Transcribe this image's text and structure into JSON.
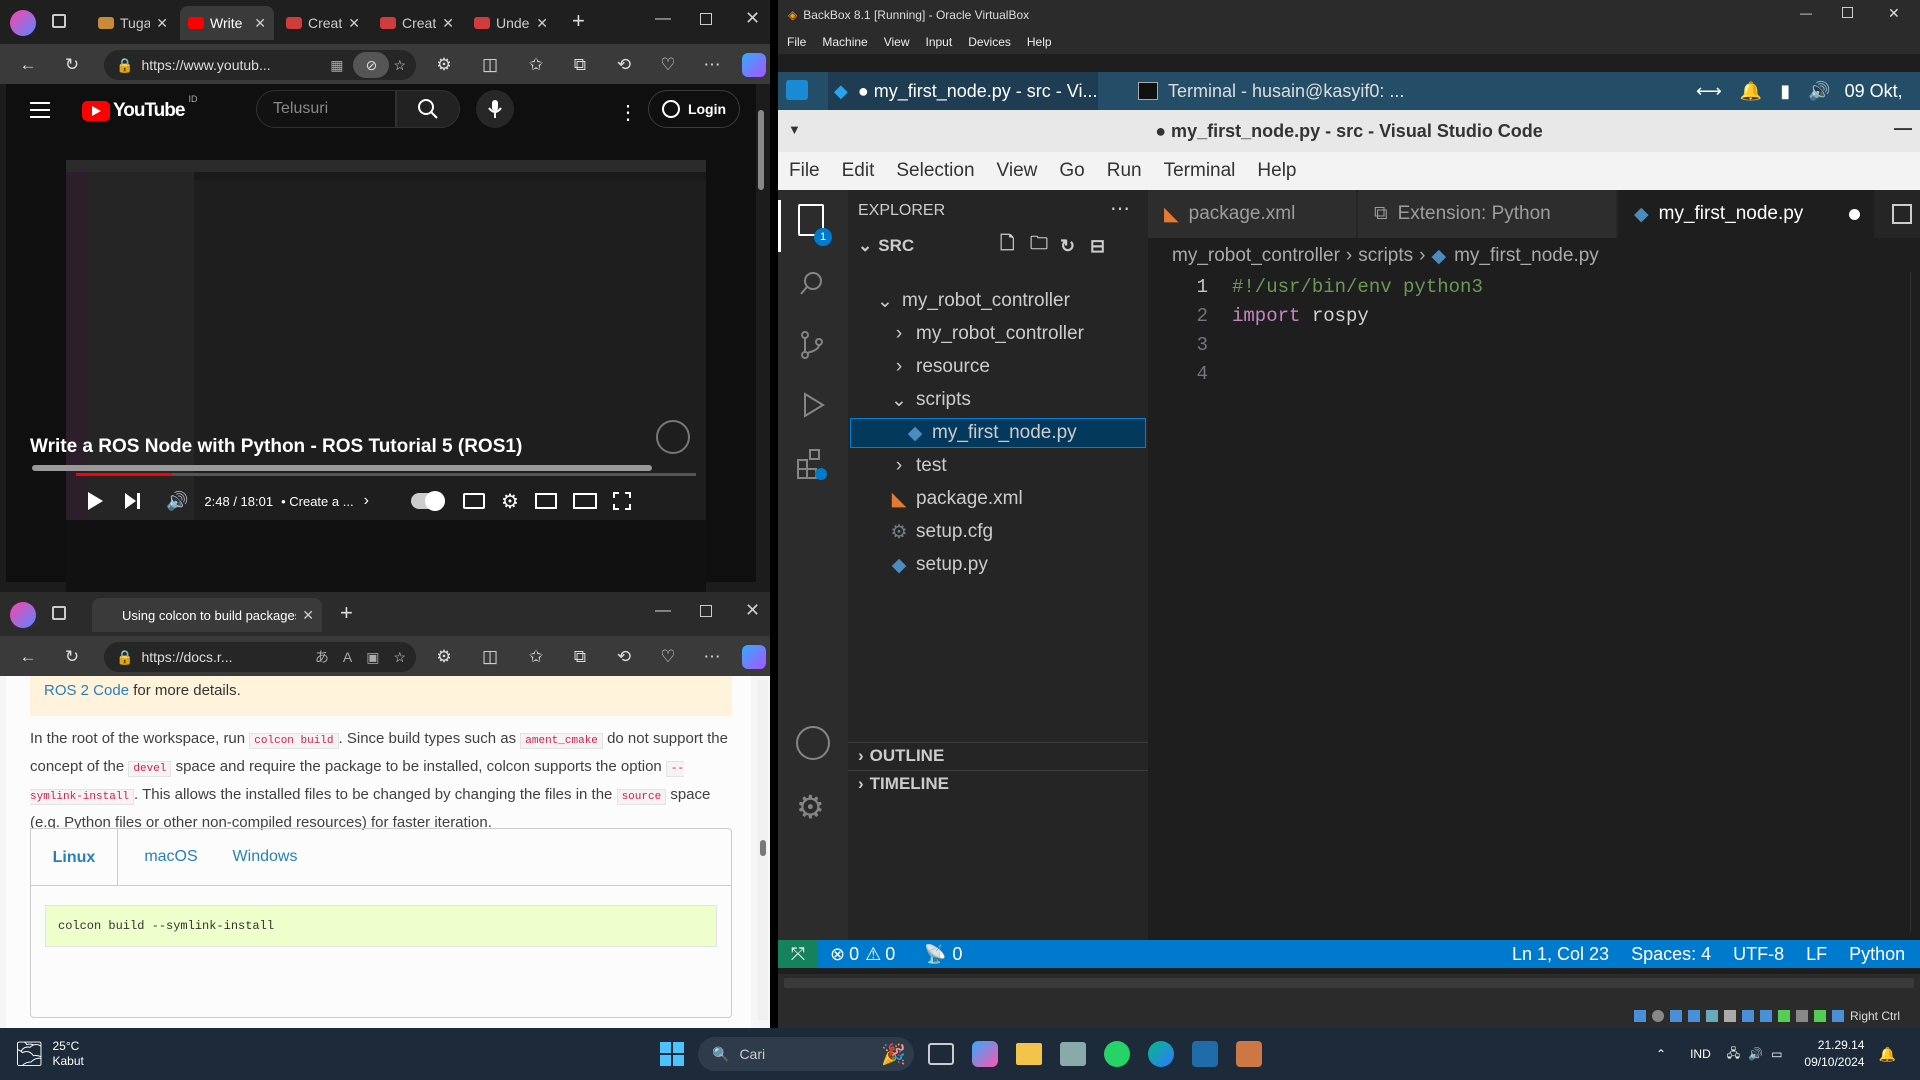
{
  "edge_top": {
    "tabs": [
      {
        "label": "Tugas",
        "color": "#c98a3b"
      },
      {
        "label": "Write",
        "color": "#ff0000",
        "active": true
      },
      {
        "label": "Create",
        "color": "#d03c3c"
      },
      {
        "label": "Create",
        "color": "#d03c3c"
      },
      {
        "label": "Under",
        "color": "#d03c3c"
      }
    ],
    "address": "https://www.youtub..."
  },
  "youtube": {
    "logo_text": "YouTube",
    "region": "ID",
    "search_placeholder": "Telusuri",
    "login_label": "Login",
    "time": "2:48 / 18:01",
    "chapter": "• Create a ...",
    "title": "Write a ROS Node with Python - ROS Tutorial 5 (ROS1)",
    "progress": 0.155
  },
  "edge_bottom": {
    "tab_label": "Using colcon to build packages —",
    "address": "https://docs.r...",
    "note_link": "ROS 2 Code",
    "note_rest": " for more details.",
    "para": {
      "t1": "In the root of the workspace, run ",
      "c1": "colcon build",
      "t2": ". Since build types such as ",
      "c2": "ament_cmake",
      "t3": " do not support the concept of the ",
      "c3": "devel",
      "t4": " space and require the package to be installed, colcon supports the option ",
      "c4": "--symlink-install",
      "t5": ". This allows the installed files to be changed by changing the files in the ",
      "c5": "source",
      "t6": " space (e.g. Python files or other non-compiled resources) for faster iteration."
    },
    "os_tabs": [
      "Linux",
      "macOS",
      "Windows"
    ],
    "command": "colcon build --symlink-install"
  },
  "vbox": {
    "title": "BackBox 8.1 [Running] - Oracle VirtualBox",
    "menu": [
      "File",
      "Machine",
      "View",
      "Input",
      "Devices",
      "Help"
    ],
    "panel_task1": "● my_first_node.py - src - Vi...",
    "panel_task2": "Terminal - husain@kasyif0: ...",
    "panel_date": "09 Okt,",
    "right_ctrl": "Right Ctrl"
  },
  "vscode": {
    "title": "● my_first_node.py - src - Visual Studio Code",
    "menu": [
      "File",
      "Edit",
      "Selection",
      "View",
      "Go",
      "Run",
      "Terminal",
      "Help"
    ],
    "explorer_label": "EXPLORER",
    "badge": "1",
    "root": "SRC",
    "tree": [
      {
        "label": "my_robot_controller",
        "indent": 1,
        "kind": "open"
      },
      {
        "label": "my_robot_controller",
        "indent": 2,
        "kind": "closed"
      },
      {
        "label": "resource",
        "indent": 2,
        "kind": "closed"
      },
      {
        "label": "scripts",
        "indent": 2,
        "kind": "open"
      },
      {
        "label": "my_first_node.py",
        "indent": 3,
        "kind": "py",
        "selected": true
      },
      {
        "label": "test",
        "indent": 2,
        "kind": "closed"
      },
      {
        "label": "package.xml",
        "indent": 2,
        "kind": "xml"
      },
      {
        "label": "setup.cfg",
        "indent": 2,
        "kind": "cfg"
      },
      {
        "label": "setup.py",
        "indent": 2,
        "kind": "py"
      }
    ],
    "outline": "OUTLINE",
    "timeline": "TIMELINE",
    "tabs": [
      "package.xml",
      "Extension: Python",
      "my_first_node.py"
    ],
    "breadcrumb": [
      "my_robot_controller",
      "scripts",
      "my_first_node.py"
    ],
    "lines": [
      {
        "n": "1",
        "parts": [
          {
            "t": "#!/usr/bin/env python3",
            "c": "#6a9955"
          }
        ]
      },
      {
        "n": "2",
        "parts": [
          {
            "t": "import",
            "c": "#c586c0"
          },
          {
            "t": " rospy",
            "c": "#d4d4d4"
          }
        ]
      },
      {
        "n": "3",
        "parts": []
      },
      {
        "n": "4",
        "parts": []
      }
    ],
    "status": {
      "errors": "0",
      "warnings": "0",
      "ports": "0",
      "position": "Ln 1, Col 23",
      "spaces": "Spaces: 4",
      "encoding": "UTF-8",
      "eol": "LF",
      "language": "Python"
    }
  },
  "taskbar": {
    "temp": "25°C",
    "weather": "Kabut",
    "search": "Cari",
    "lang": "IND",
    "time": "21.29.14",
    "date": "09/10/2024"
  }
}
